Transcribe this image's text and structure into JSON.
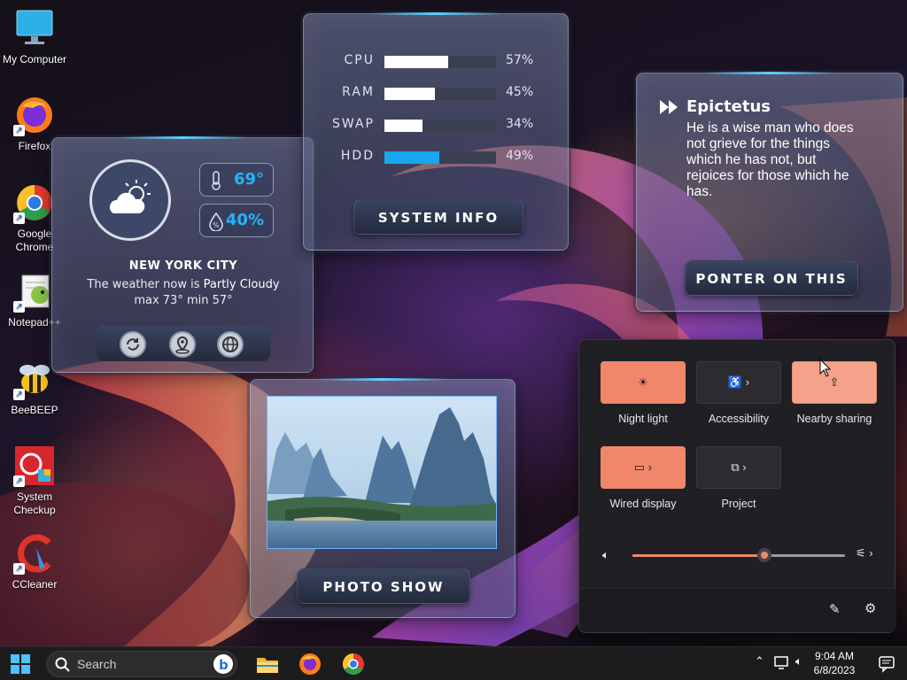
{
  "desktop_icons": [
    {
      "label": "My Computer",
      "icon": "monitor-icon"
    },
    {
      "label": "Firefox",
      "icon": "firefox-icon"
    },
    {
      "label": "Google Chrome",
      "icon": "chrome-icon"
    },
    {
      "label": "Notepad++",
      "icon": "notepadpp-icon"
    },
    {
      "label": "BeeBEEP",
      "icon": "bee-icon"
    },
    {
      "label": "System Checkup",
      "icon": "system-checkup-icon"
    },
    {
      "label": "CCleaner",
      "icon": "ccleaner-icon"
    }
  ],
  "weather": {
    "temperature": "69°",
    "humidity": "40%",
    "city": "NEW YORK CITY",
    "now_prefix": "The weather now is",
    "condition": "Partly Cloudy",
    "range": "max 73° min 57°"
  },
  "sysinfo": {
    "rows": [
      {
        "label": "CPU",
        "percent": 57,
        "text": "57%",
        "color": "#ffffff"
      },
      {
        "label": "RAM",
        "percent": 45,
        "text": "45%",
        "color": "#ffffff"
      },
      {
        "label": "SWAP",
        "percent": 34,
        "text": "34%",
        "color": "#ffffff"
      },
      {
        "label": "HDD",
        "percent": 49,
        "text": "49%",
        "color": "#1aa6ee"
      }
    ],
    "button": "SYSTEM INFO"
  },
  "quote": {
    "author": "Epictetus",
    "text": "He is a wise man who does not grieve for the things which he has not, but rejoices for those which he has.",
    "button": "PONTER ON THIS"
  },
  "photo": {
    "button": "PHOTO SHOW"
  },
  "quick_settings": {
    "tiles": [
      {
        "label": "Night light",
        "active": true
      },
      {
        "label": "Accessibility",
        "active": false
      },
      {
        "label": "Nearby sharing",
        "active": true
      },
      {
        "label": "Wired display",
        "active": true
      },
      {
        "label": "Project",
        "active": false
      }
    ],
    "volume": 62,
    "accent": "#f0876a"
  },
  "taskbar": {
    "search_placeholder": "Search",
    "time": "9:04 AM",
    "date": "6/8/2023"
  }
}
